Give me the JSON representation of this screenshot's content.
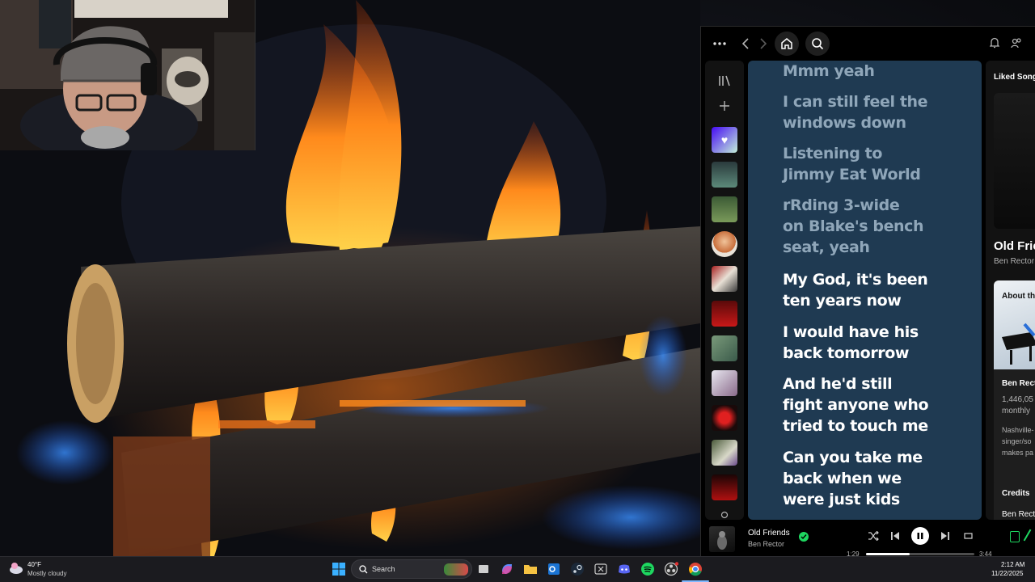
{
  "spotify": {
    "topbar": {
      "more_icon": "more-dots-icon",
      "back_icon": "chevron-left-icon",
      "forward_icon": "chevron-right-icon",
      "home_icon": "home-icon",
      "search_icon": "search-icon",
      "bell_icon": "bell-icon",
      "friends_icon": "friends-icon"
    },
    "sidebar": {
      "library_icon": "library-icon",
      "add_icon": "plus-icon",
      "liked_icon": "heart-icon",
      "items": [
        "playlist",
        "album",
        "artist",
        "album",
        "album",
        "album",
        "album",
        "album",
        "album",
        "album"
      ]
    },
    "lyrics": {
      "lines": [
        {
          "text": "Mmm yeah",
          "state": "past"
        },
        {
          "text": "I can still feel the windows down",
          "state": "past"
        },
        {
          "text": "Listening to Jimmy Eat World",
          "state": "past"
        },
        {
          "text": "rRding 3-wide on Blake's bench seat, yeah",
          "state": "past"
        },
        {
          "text": "My God, it's been ten years now",
          "state": "active"
        },
        {
          "text": "I would have his back tomorrow",
          "state": "active"
        },
        {
          "text": "And he'd still fight anyone who tried to touch me",
          "state": "active"
        },
        {
          "text": "Can you take me back when we were just kids",
          "state": "active"
        }
      ],
      "line_break": {
        "l1": [
          "I can still feel the",
          "windows down"
        ],
        "l2": [
          "Listening to",
          "Jimmy Eat World"
        ],
        "l3": [
          "rRding 3-wide",
          "on Blake's bench",
          "seat, yeah"
        ],
        "l4": [
          "My God, it's been",
          "ten years now"
        ],
        "l5": [
          "I would have his",
          "back tomorrow"
        ],
        "l6": [
          "And he'd still",
          "fight anyone who",
          "tried to touch me"
        ],
        "l7": [
          "Can you take me",
          "back when we",
          "were just kids"
        ]
      }
    },
    "right_panel": {
      "playlist_title": "Liked Songs",
      "song_title": "Old Frie",
      "artist": "Ben Rector",
      "about_label": "About th",
      "artist_card_name": "Ben Rect",
      "listeners": "1,446,05",
      "listeners_suffix": "monthly",
      "bio_1": "Nashville-",
      "bio_2": "singer/so",
      "bio_3": "makes pa",
      "credits_label": "Credits",
      "credits_artist": "Ben Rect"
    },
    "player": {
      "track_title": "Old Friends",
      "track_artist": "Ben Rector",
      "elapsed": "1:29",
      "duration": "3:44",
      "progress": 0.4,
      "shuffle_icon": "shuffle-icon",
      "prev_icon": "previous-icon",
      "pause_icon": "pause-icon",
      "next_icon": "next-icon",
      "repeat_icon": "repeat-icon",
      "saved_icon": "check-circle-icon"
    }
  },
  "taskbar": {
    "weather_temp": "40°F",
    "weather_desc": "Mostly cloudy",
    "search_label": "Search",
    "time": "2:12 AM",
    "date": "11/22/2025",
    "apps": [
      "windows-start-icon",
      "task-view-icon",
      "copilot-icon",
      "file-explorer-icon",
      "outlook-icon",
      "steam-icon",
      "xbox-icon",
      "discord-icon",
      "spotify-icon",
      "obs-icon",
      "chrome-icon"
    ]
  },
  "colors": {
    "lyrics_bg": "#1f3a52",
    "lyrics_past": "#8fa6b9",
    "lyrics_active": "#ffffff",
    "spotify_green": "#1ed760"
  }
}
